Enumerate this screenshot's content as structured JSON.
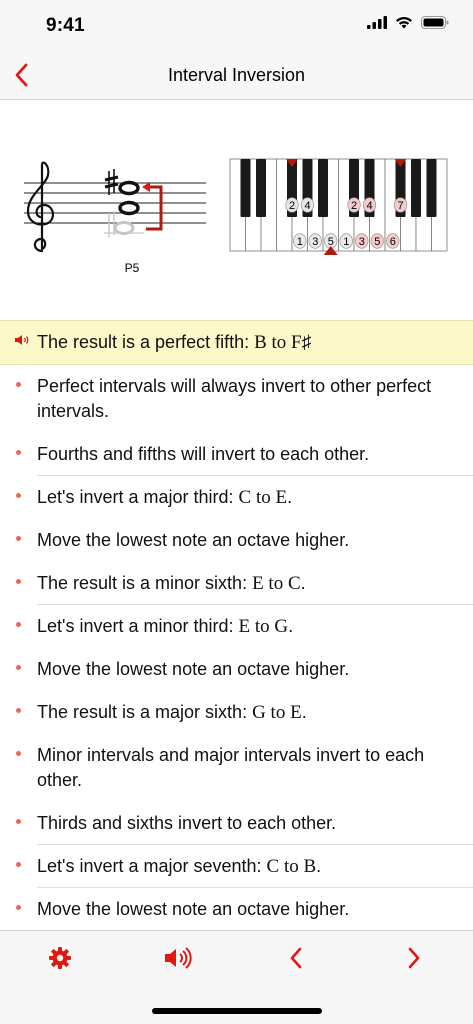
{
  "status_bar": {
    "time": "9:41"
  },
  "nav": {
    "title": "Interval Inversion"
  },
  "diagram": {
    "interval_label": "P5",
    "piano_white_labels": [
      "1",
      "3",
      "5",
      "1",
      "3",
      "5",
      "6"
    ],
    "piano_black_labels": [
      "2",
      "4",
      "2",
      "4",
      "7"
    ]
  },
  "list": {
    "items": [
      {
        "pre": "The result is a perfect fifth: ",
        "notes": "B to F♯",
        "post": ""
      },
      {
        "pre": "Perfect intervals will always invert to other perfect intervals.",
        "notes": "",
        "post": ""
      },
      {
        "pre": "Fourths and fifths will invert to each other.",
        "notes": "",
        "post": ""
      },
      {
        "pre": "Let's invert a major third: ",
        "notes": "C to E",
        "post": "."
      },
      {
        "pre": "Move the lowest note an octave higher.",
        "notes": "",
        "post": ""
      },
      {
        "pre": "The result is a minor sixth: ",
        "notes": "E to C",
        "post": "."
      },
      {
        "pre": "Let's invert a minor third: ",
        "notes": "E to G",
        "post": "."
      },
      {
        "pre": "Move the lowest note an octave higher.",
        "notes": "",
        "post": ""
      },
      {
        "pre": "The result is a major sixth: ",
        "notes": "G to E",
        "post": "."
      },
      {
        "pre": "Minor intervals and major intervals invert to each other.",
        "notes": "",
        "post": ""
      },
      {
        "pre": "Thirds and sixths invert to each other.",
        "notes": "",
        "post": ""
      },
      {
        "pre": "Let's invert a major seventh: ",
        "notes": "C to B",
        "post": "."
      },
      {
        "pre": "Move the lowest note an octave higher.",
        "notes": "",
        "post": ""
      }
    ]
  },
  "colors": {
    "accent": "#e0190f",
    "highlight": "#fdf8c9",
    "dark_red": "#b01a0e"
  },
  "icons": {
    "back": "chevron-left-icon",
    "settings": "gear-icon",
    "speaker": "speaker-icon",
    "prev": "chevron-left-icon",
    "next": "chevron-right-icon"
  }
}
